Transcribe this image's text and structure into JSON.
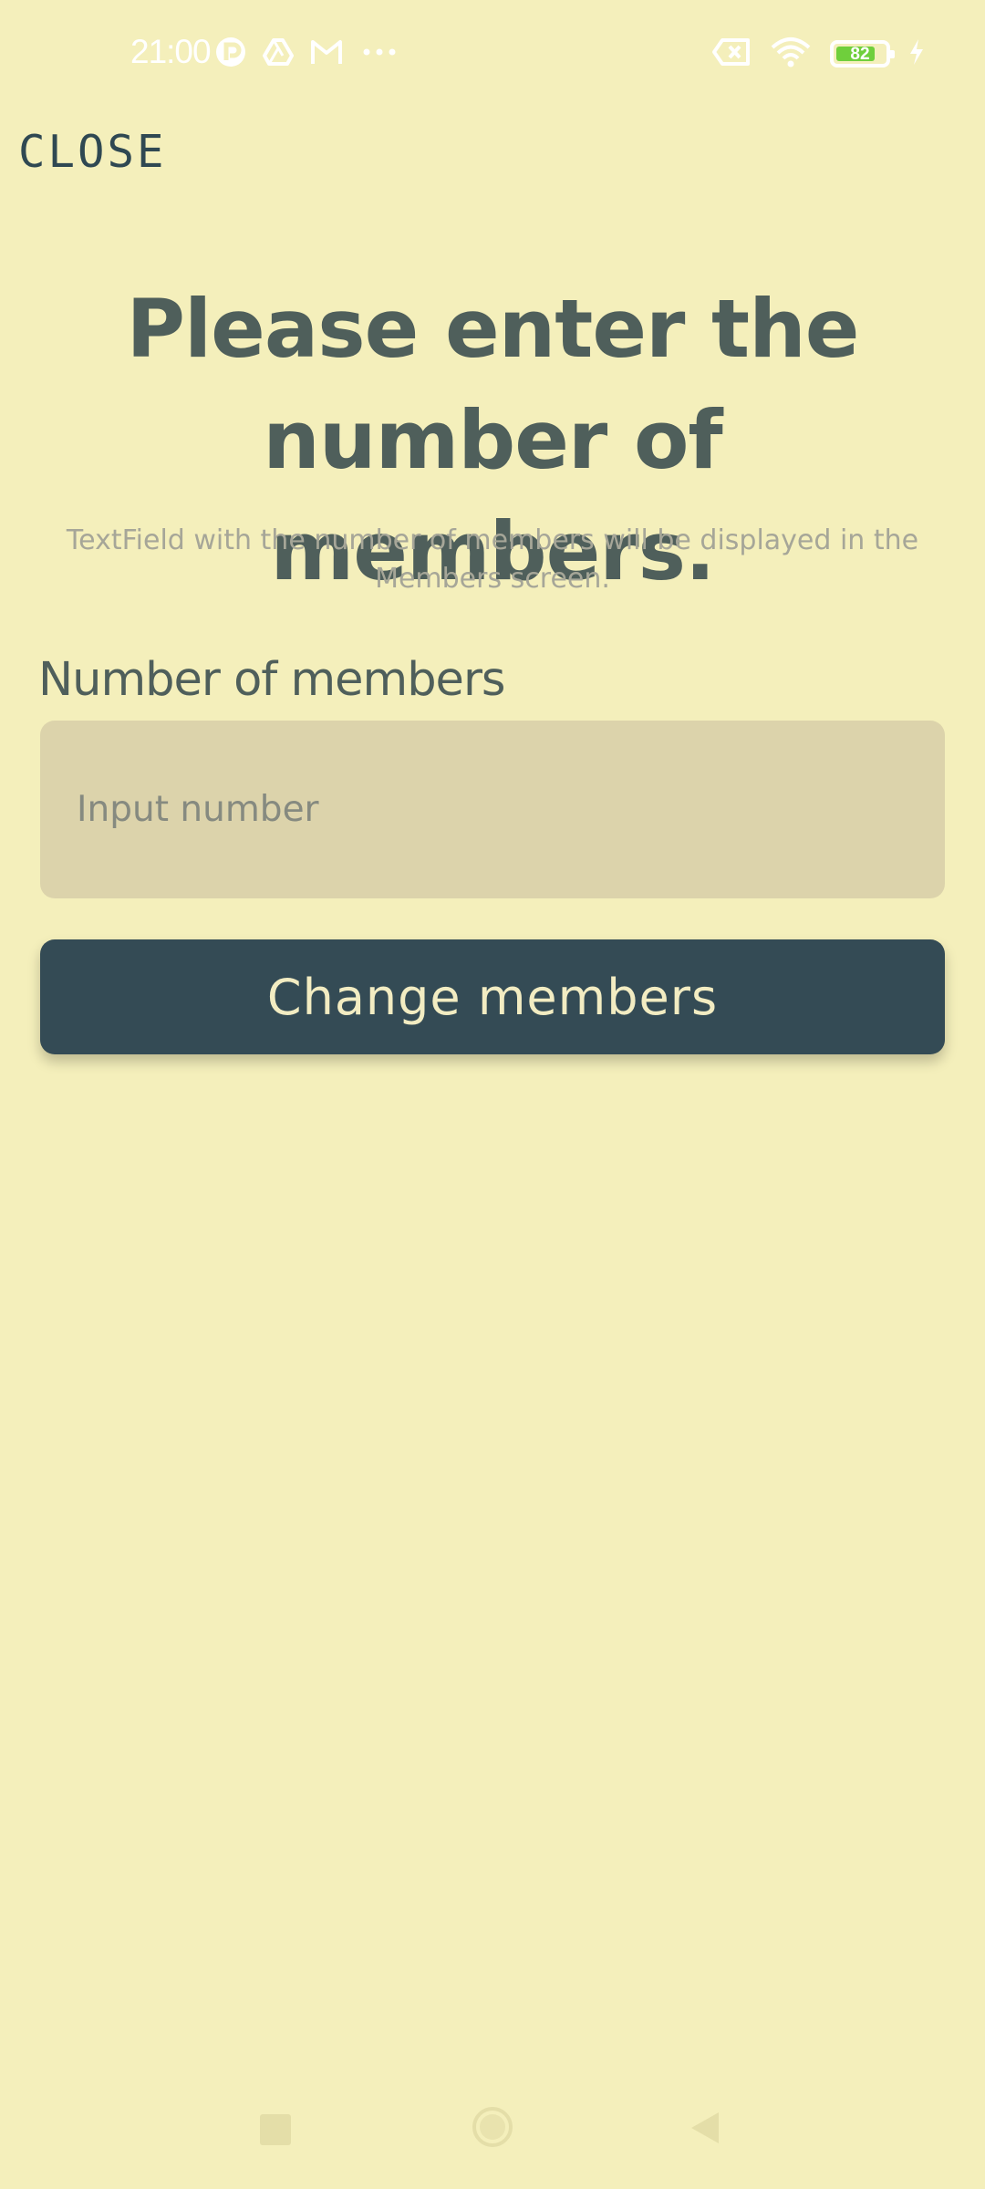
{
  "status_bar": {
    "time": "21:00",
    "left_icons": [
      "r-app-icon",
      "drive-icon",
      "gmail-icon",
      "more-dots-icon"
    ],
    "right_icons": [
      "no-sim-icon",
      "wifi-icon",
      "battery-icon",
      "charging-icon"
    ],
    "battery_level": "82",
    "battery_fraction": 0.82
  },
  "header": {
    "close_label": "CLOSE"
  },
  "main": {
    "title_line1": "Please enter the",
    "title_line2": "number of members.",
    "subtitle_line1": "TextField with the number of members will be displayed in the",
    "subtitle_line2": "Members screen.",
    "field_label": "Number of members",
    "input_placeholder": "Input number",
    "input_value": "",
    "button_label": "Change members"
  },
  "nav_bar": {
    "icons": [
      "recents-square-icon",
      "home-circle-icon",
      "back-triangle-icon"
    ]
  },
  "colors": {
    "background": "#f4efbb",
    "title": "#4f5f5b",
    "subtitle": "#a6a698",
    "input_background": "#dcd3ab",
    "button_background": "#344b55",
    "button_text": "#f2ecc2",
    "close_text": "#2f4852",
    "battery_fill": "#6fcf3c"
  }
}
